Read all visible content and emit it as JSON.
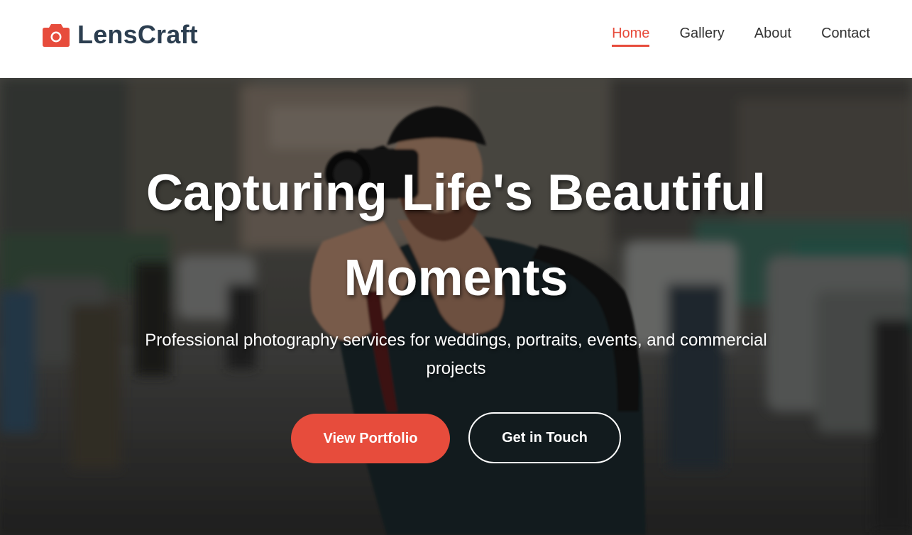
{
  "brand": {
    "name": "LensCraft",
    "icon": "camera-icon",
    "accent_color": "#e74c3c",
    "text_color": "#2c3e50"
  },
  "nav": {
    "items": [
      {
        "label": "Home",
        "active": true
      },
      {
        "label": "Gallery",
        "active": false
      },
      {
        "label": "About",
        "active": false
      },
      {
        "label": "Contact",
        "active": false
      }
    ]
  },
  "hero": {
    "title": "Capturing Life's Beautiful Moments",
    "subtitle": "Professional photography services for weddings, portraits, events, and commercial projects",
    "primary_button": "View Portfolio",
    "secondary_button": "Get in Touch",
    "primary_color": "#e74c3c"
  }
}
